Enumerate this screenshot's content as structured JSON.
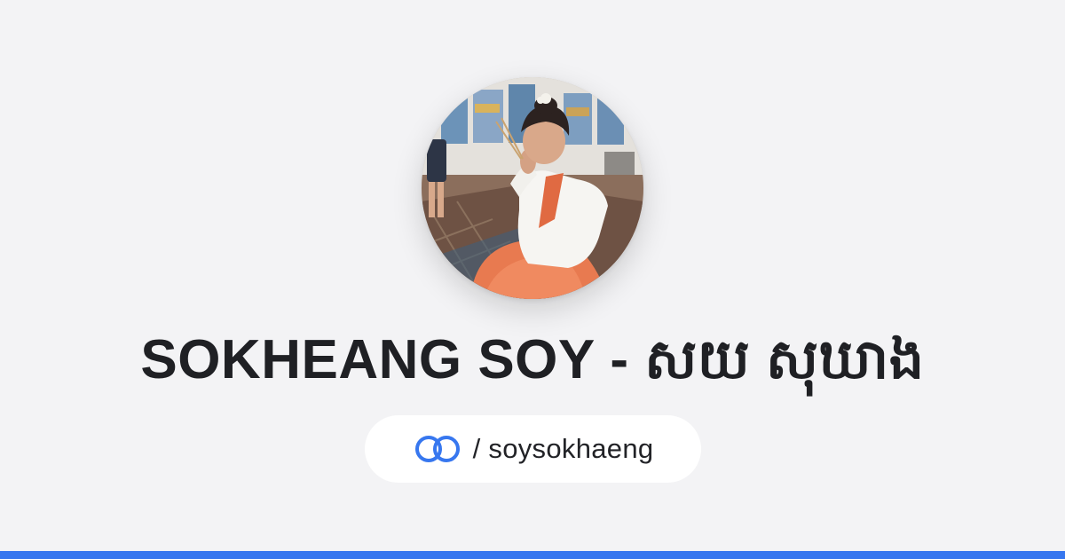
{
  "profile": {
    "name": "SOKHEANG SOY - សយ សុឃាង",
    "handle": "/ soysokhaeng",
    "avatar_icon": "profile-photo"
  },
  "brand": {
    "logo_icon": "interlocking-rings-icon",
    "accent_color": "#3777ef",
    "background_color": "#f3f3f5"
  }
}
